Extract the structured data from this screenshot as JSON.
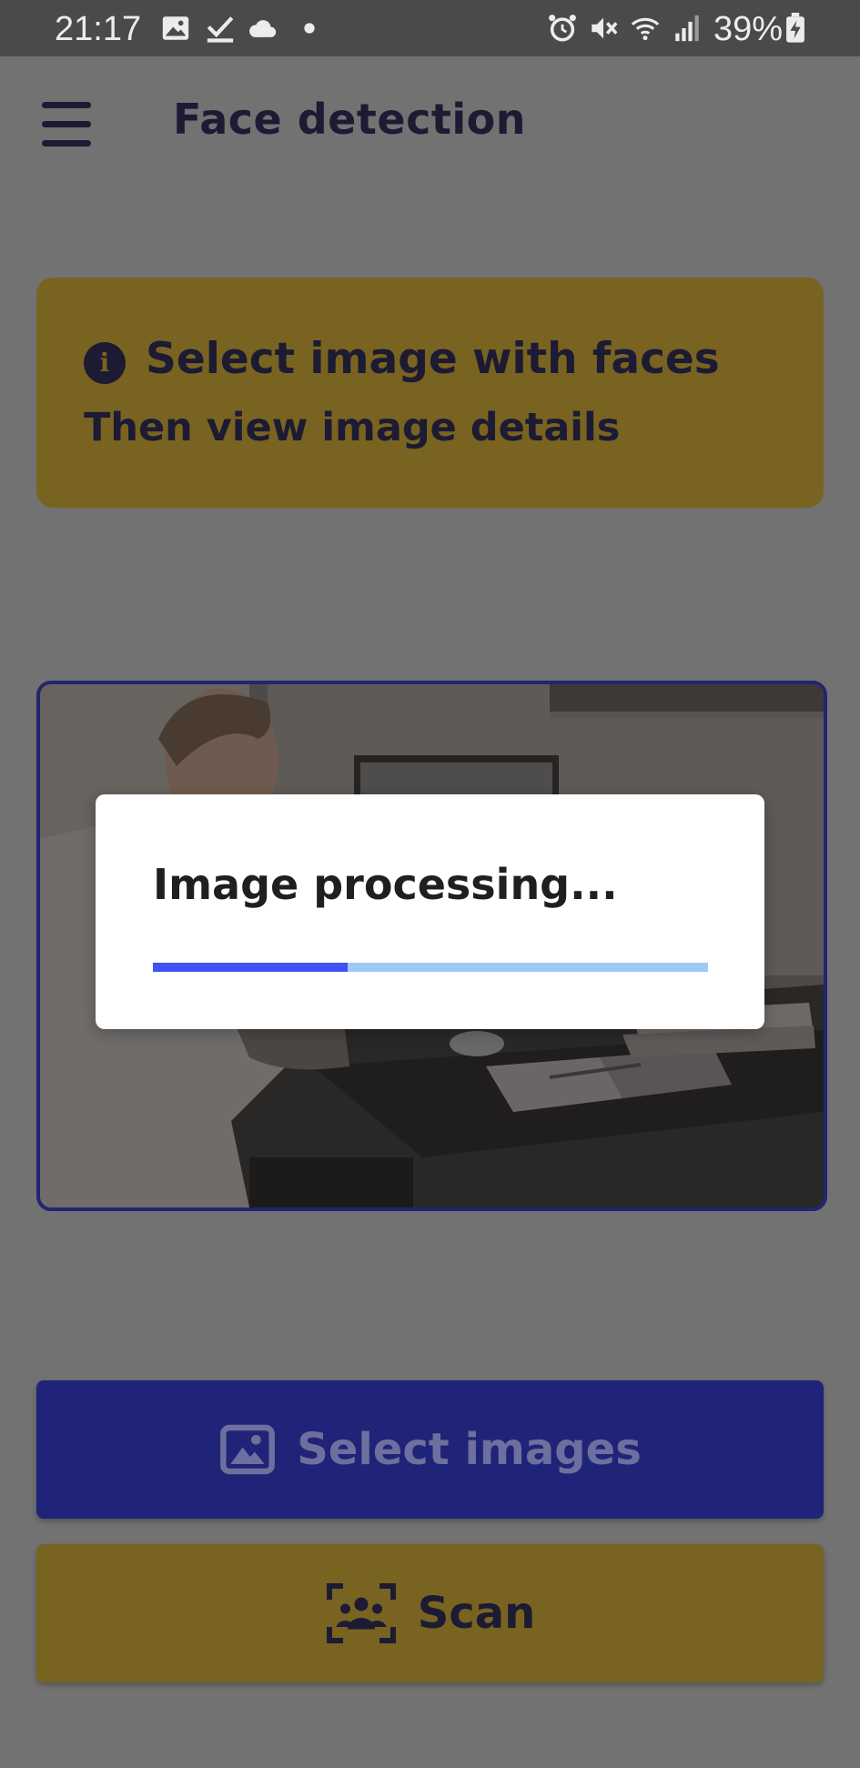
{
  "status_bar": {
    "time": "21:17",
    "battery": "39%",
    "left_icons": [
      "gallery-icon",
      "check-icon",
      "cloud-icon",
      "dot-icon"
    ],
    "right_icons": [
      "alarm-icon",
      "mute-icon",
      "wifi-icon",
      "signal-icon",
      "battery-charging-icon"
    ]
  },
  "app_bar": {
    "title": "Face detection",
    "menu_icon": "hamburger-menu-icon"
  },
  "info_card": {
    "icon": "info-icon",
    "icon_glyph": "i",
    "title": "Select image with faces",
    "subtitle": "Then view image details"
  },
  "dialog": {
    "message": "Image processing...",
    "progress": 0.35
  },
  "buttons": {
    "select_images": {
      "label": "Select images",
      "icon": "image-icon"
    },
    "scan": {
      "label": "Scan",
      "icon": "face-scan-icon"
    }
  },
  "colors": {
    "accent_yellow": "#786420",
    "accent_blue": "#1f2478",
    "text_dark": "#1d1a34",
    "progress_fill": "#3f52f4",
    "progress_track": "#9ccaf8"
  }
}
